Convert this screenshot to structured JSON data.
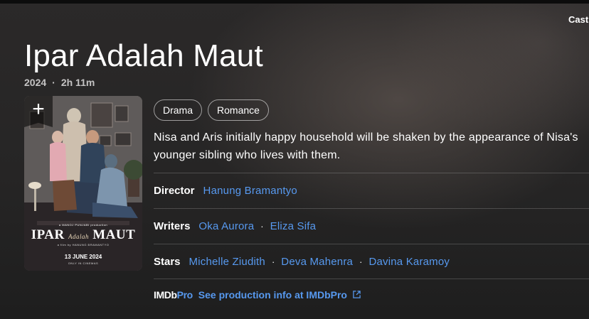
{
  "header": {
    "cast_link": "Cast"
  },
  "title": {
    "text": "Ipar Adalah Maut",
    "year": "2024",
    "separator": "·",
    "runtime": "2h 11m"
  },
  "poster": {
    "add_symbol": "+",
    "credit_top": "a MANOJ PUNJABI production",
    "title_left": "IPAR",
    "title_script": "Adalah",
    "title_right": "MAUT",
    "director_line": "a film by HANUNG BRAMANTYO",
    "release_date": "13 JUNE 2024",
    "release_note": "ONLY IN CINEMAS"
  },
  "genres": [
    "Drama",
    "Romance"
  ],
  "plot": "Nisa and Aris initially happy household will be shaken by the appearance of Nisa's younger sibling who lives with them.",
  "credits": {
    "director": {
      "label": "Director",
      "names": [
        "Hanung Bramantyo"
      ]
    },
    "writers": {
      "label": "Writers",
      "names": [
        "Oka Aurora",
        "Eliza Sifa"
      ]
    },
    "stars": {
      "label": "Stars",
      "names": [
        "Michelle Ziudith",
        "Deva Mahenra",
        "Davina Karamoy"
      ]
    },
    "separator": "·"
  },
  "imdbpro": {
    "logo_imdb": "IMDb",
    "logo_pro": "Pro",
    "link_text": "See production info at IMDbPro",
    "icon": "external-link-icon"
  },
  "colors": {
    "link": "#5799ef",
    "background": "#1f1f1f"
  }
}
